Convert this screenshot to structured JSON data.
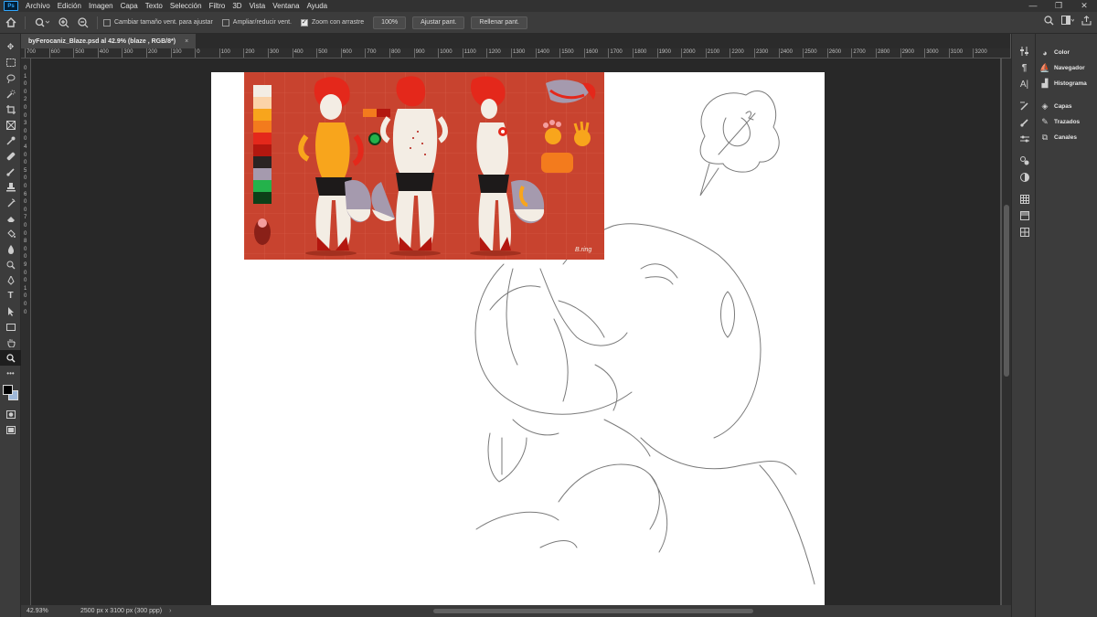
{
  "app": {
    "logo": "Ps"
  },
  "menu": [
    "Archivo",
    "Edición",
    "Imagen",
    "Capa",
    "Texto",
    "Selección",
    "Filtro",
    "3D",
    "Vista",
    "Ventana",
    "Ayuda"
  ],
  "window_controls": {
    "minimize": "—",
    "restore": "❐",
    "close": "✕"
  },
  "options": {
    "resize_windows": "Cambiar tamaño vent. para ajustar",
    "zoom_all": "Ampliar/reducir vent.",
    "scrubby_zoom": "Zoom con arrastre",
    "zoom_value": "100%",
    "fit_screen": "Ajustar pant.",
    "fill_screen": "Rellenar pant.",
    "resize_checked": false,
    "zoom_all_checked": false,
    "scrubby_checked": true
  },
  "document": {
    "tab_title": "byFerocaniz_Blaze.psd al 42.9% (blaze , RGB/8*)",
    "close": "×"
  },
  "ruler": {
    "h_labels": [
      "700",
      "600",
      "500",
      "400",
      "300",
      "200",
      "100",
      "0",
      "100",
      "200",
      "300",
      "400",
      "500",
      "600",
      "700",
      "800",
      "900",
      "1000",
      "1100",
      "1200",
      "1300",
      "1400",
      "1500",
      "1600",
      "1700",
      "1800",
      "1900",
      "2000",
      "2100",
      "2200",
      "2300",
      "2400",
      "2500",
      "2600",
      "2700",
      "2800",
      "2900",
      "3000",
      "3100",
      "3200"
    ],
    "v_labels": [
      "0",
      "1",
      "0",
      "0",
      "2",
      "0",
      "0",
      "3",
      "0",
      "0",
      "4",
      "0",
      "0",
      "5",
      "0",
      "0",
      "6",
      "0",
      "0",
      "7",
      "0",
      "0",
      "8",
      "0",
      "0",
      "9",
      "0",
      "0",
      "1",
      "0",
      "0",
      "0"
    ]
  },
  "status": {
    "zoom": "42.93%",
    "doc_info": "2500 px x 3100 px (300 ppp)"
  },
  "panels": [
    {
      "icon": "color-icon",
      "label": "Color"
    },
    {
      "icon": "navigator-icon",
      "label": "Navegador"
    },
    {
      "icon": "histogram-icon",
      "label": "Histograma"
    },
    {
      "icon": "layers-icon",
      "label": "Capas"
    },
    {
      "icon": "paths-icon",
      "label": "Trazados"
    },
    {
      "icon": "channels-icon",
      "label": "Canales"
    }
  ],
  "colors": {
    "app_bg": "#535353",
    "workspace": "#282828",
    "canvas": "#ffffff",
    "reference_sheet": "#c8432f",
    "palette": [
      "#f3ede4",
      "#fbd3a8",
      "#f8a51c",
      "#f37b1d",
      "#e4281b",
      "#b3170f",
      "#2a2423",
      "#a59aae",
      "#24b24b",
      "#0d4018"
    ]
  }
}
